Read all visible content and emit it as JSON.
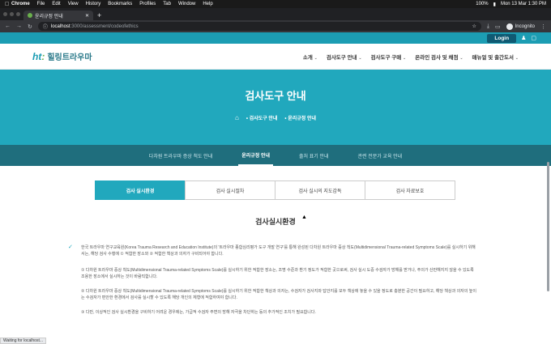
{
  "os_menu": {
    "items": [
      "Chrome",
      "File",
      "Edit",
      "View",
      "History",
      "Bookmarks",
      "Profiles",
      "Tab",
      "Window",
      "Help"
    ],
    "battery": "100%",
    "datetime": "Mon 13 Mar  1:30 PM"
  },
  "browser": {
    "tab_title": "윤리규정 안내",
    "url_host": "localhost",
    "url_path": ":3000/assessment/codeofethics",
    "profile": "Incognito"
  },
  "site": {
    "login_label": "Login",
    "logo_text": "힐링트라우마",
    "nav": [
      "소개",
      "검사도구 안내",
      "검사도구 구매",
      "온라인 검사 및 채점",
      "매뉴얼 및 출간도서"
    ],
    "hero_title": "검사도구 안내",
    "breadcrumb": [
      "검사도구 안내",
      "윤리규정 안내"
    ],
    "subtabs": [
      "다차원 트라우마 증상 척도 안내",
      "윤리규정 안내",
      "출처 표기 안내",
      "관련 전문가 교육 안내"
    ],
    "content_tabs": [
      "검사 실시환경",
      "검사 실시절차",
      "검사 실시의 지도감독",
      "검사 자료보호"
    ],
    "section_title": "검사실시환경",
    "paragraphs": [
      "한국 트라우마 연구교육원(Korea Trauma Research and Education Institute)의 '트라우마 종합심리평가 도구 개발 연구'를 통해 완성된 다차원 트라우마 증상 척도(Multidimensional Trauma-related Symptoms Scale)를 실시하기 위해서는, 해당 검사 수행에 ① 적합한 장소와 ② 적합한 책상과 의자가 구비되어야 합니다.",
      "① 다차원 트라우마 증상 척도(Multidimensional Trauma-related Symptoms Scale)를 실시하기 위한 적합한 장소는, 조명 수준과 환기 정도가 적합한 곳으로써, 검사 실시 도중 수검자가 방해를 받거나, 주의가 산만해지지 않을 수 있도록 조용한 장소에서 실시하는 것이 바람직합니다.",
      "② 다차원 트라우마 증상 척도(Multidimensional Trauma-related Symptoms Scale)를 실시하기 위한 적합한 책상과 의자는, 수검자가 검사지와 답안지를 모두 책상에 놓을 수 있을 정도로 충분한 공간이 필요하고, 해당 책상과 의자의 높이는 수검자가 편안한 환경에서 검사를 실시할 수 있도록 해당 개인의 체형에 적합하여야 합니다.",
      "③ 다만, 이상적인 검사 실시환경을 구비하기 어려운 경우에는, 가급적 수검자 주변의 방해 자극을 차단하는 등의 추가적인 조치가 필요합니다."
    ]
  },
  "status_text": "Waiting for localhost..."
}
